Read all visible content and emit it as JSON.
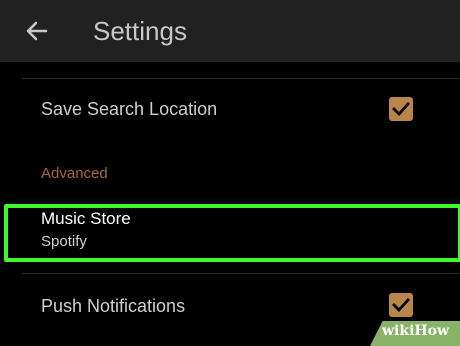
{
  "header": {
    "title": "Settings",
    "back_icon": "arrow-left-icon"
  },
  "settings": {
    "save_search_location": {
      "label": "Save Search Location",
      "checked": true
    },
    "advanced_header": "Advanced",
    "music_store": {
      "label": "Music Store",
      "value": "Spotify"
    },
    "push_notifications": {
      "label": "Push Notifications",
      "checked": true
    }
  },
  "watermark": {
    "text": "wikiHow"
  },
  "colors": {
    "topbar": "#212121",
    "background": "#000000",
    "accent": "#b8854a",
    "section_header": "#a8683b",
    "highlight": "#3ff52b"
  }
}
